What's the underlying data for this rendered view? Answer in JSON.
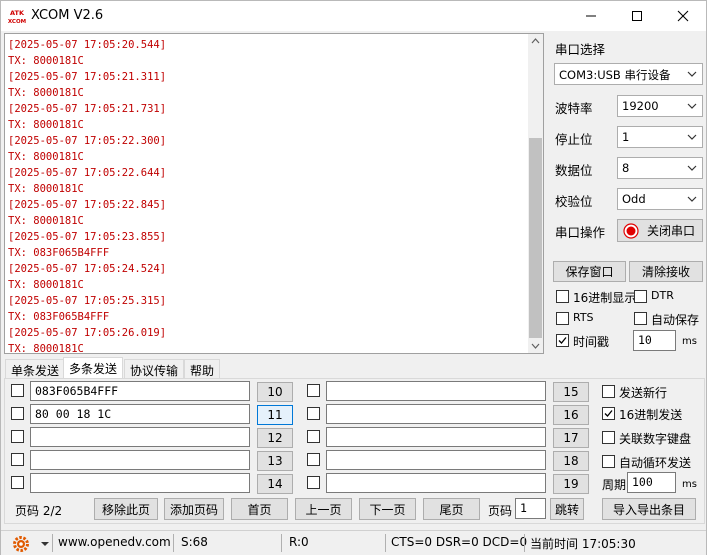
{
  "window": {
    "title": "XCOM V2.6",
    "logo_text": "ATK XCOM"
  },
  "receive": {
    "lines": [
      "[2025-05-07 17:05:20.544]",
      "TX: 8000181C",
      "[2025-05-07 17:05:21.311]",
      "TX: 8000181C",
      "[2025-05-07 17:05:21.731]",
      "TX: 8000181C",
      "[2025-05-07 17:05:22.300]",
      "TX: 8000181C",
      "[2025-05-07 17:05:22.644]",
      "TX: 8000181C",
      "[2025-05-07 17:05:22.845]",
      "TX: 8000181C",
      "[2025-05-07 17:05:23.855]",
      "TX: 083F065B4FFF",
      "[2025-05-07 17:05:24.524]",
      "TX: 8000181C",
      "[2025-05-07 17:05:25.315]",
      "TX: 083F065B4FFF",
      "[2025-05-07 17:05:26.019]",
      "TX: 8000181C"
    ]
  },
  "settings": {
    "port_select_label": "串口选择",
    "port_value": "COM3:USB 串行设备",
    "baud_label": "波特率",
    "baud_value": "19200",
    "stop_label": "停止位",
    "stop_value": "1",
    "data_label": "数据位",
    "data_value": "8",
    "parity_label": "校验位",
    "parity_value": "Odd",
    "op_label": "串口操作",
    "close_port_label": "关闭串口",
    "save_window_label": "保存窗口",
    "clear_recv_label": "清除接收",
    "hex_display_label": "16进制显示",
    "hex_display_checked": false,
    "dtr_label": "DTR",
    "dtr_checked": false,
    "rts_label": "RTS",
    "rts_checked": false,
    "auto_save_label": "自动保存",
    "auto_save_checked": false,
    "timestamp_label": "时间戳",
    "timestamp_checked": true,
    "timestamp_value": "10",
    "timestamp_unit": "ms"
  },
  "tabs": [
    "单条发送",
    "多条发送",
    "协议传输",
    "帮助"
  ],
  "active_tab": 1,
  "multi_send": {
    "rows_left": [
      {
        "value": "083F065B4FFF",
        "button": "10",
        "checked": false
      },
      {
        "value": "80 00 18 1C",
        "button": "11",
        "checked": false
      },
      {
        "value": "",
        "button": "12",
        "checked": false
      },
      {
        "value": "",
        "button": "13",
        "checked": false
      },
      {
        "value": "",
        "button": "14",
        "checked": false
      }
    ],
    "rows_right": [
      {
        "value": "",
        "button": "15",
        "checked": false
      },
      {
        "value": "",
        "button": "16",
        "checked": false
      },
      {
        "value": "",
        "button": "17",
        "checked": false
      },
      {
        "value": "",
        "button": "18",
        "checked": false
      },
      {
        "value": "",
        "button": "19",
        "checked": false
      }
    ],
    "send_newline_label": "发送新行",
    "send_newline_checked": false,
    "hex_send_label": "16进制发送",
    "hex_send_checked": true,
    "num_keyboard_label": "关联数字键盘",
    "num_keyboard_checked": false,
    "auto_loop_label": "自动循环发送",
    "auto_loop_checked": false,
    "period_label": "周期",
    "period_value": "100",
    "period_unit": "ms",
    "page_info": "页码 2/2",
    "remove_page_label": "移除此页",
    "add_page_label": "添加页码",
    "first_page_label": "首页",
    "prev_page_label": "上一页",
    "next_page_label": "下一页",
    "last_page_label": "尾页",
    "page_label": "页码",
    "page_value": "1",
    "jump_label": "跳转",
    "import_export_label": "导入导出条目"
  },
  "status": {
    "url": "www.openedv.com",
    "sent": "S:68",
    "received": "R:0",
    "signals": "CTS=0 DSR=0 DCD=0",
    "time": "当前时间 17:05:30"
  },
  "colors": {
    "recv_text": "#c00000",
    "close_port_dot": "#e00000"
  }
}
